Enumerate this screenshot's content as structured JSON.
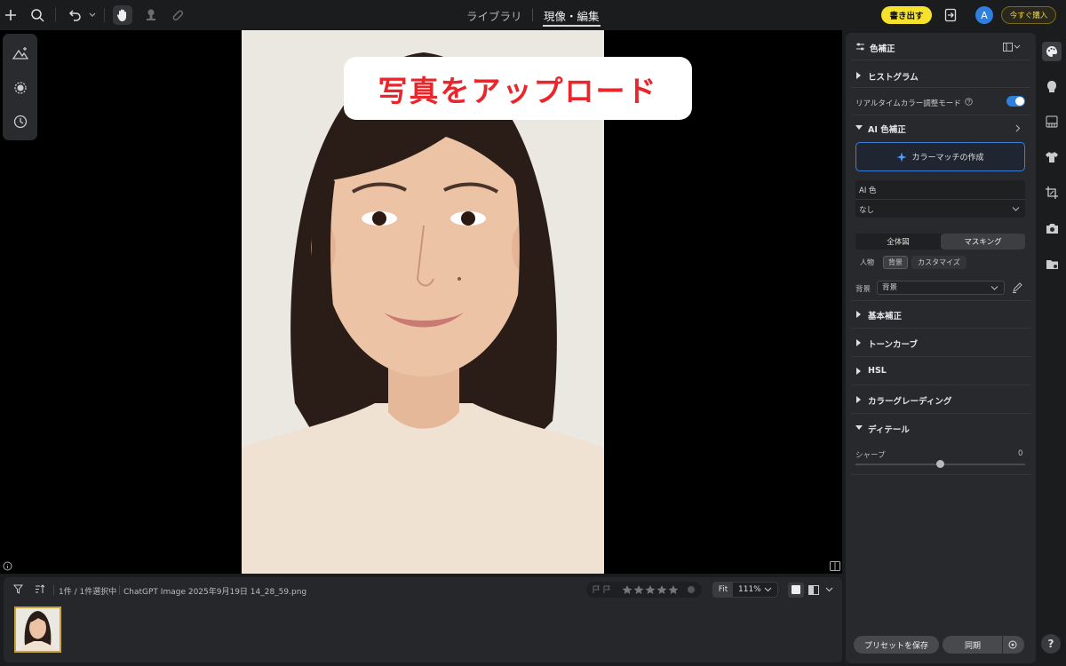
{
  "topbar": {
    "tabs": [
      {
        "label": "ライブラリ",
        "active": false
      },
      {
        "label": "現像・編集",
        "active": true
      }
    ],
    "export_label": "書き出す",
    "avatar_initial": "A",
    "buy_label": "今すぐ購入",
    "colors": {
      "export_bg": "#f6e12c",
      "avatar_bg": "#2f7fe0",
      "buy_text": "#f1d84a"
    }
  },
  "canvas": {
    "overlay_text": "写真をアップロード",
    "overlay_color": "#e8262b"
  },
  "filmstrip": {
    "selection_text": "1件 / 1件選択中",
    "file_name": "ChatGPT Image 2025年9月19日 14_28_59.png",
    "fit_label": "Fit",
    "zoom": "111%",
    "stars": 0
  },
  "panel": {
    "title": "色補正",
    "histogram": "ヒストグラム",
    "realtime_label": "リアルタイムカラー調整モード",
    "realtime_on": true,
    "ai_section": "AI 色補正",
    "colormatch_label": "カラーマッチの作成",
    "ai_color_label": "AI 色",
    "ai_color_value": "なし",
    "segments": [
      "全体図",
      "マスキング"
    ],
    "chips": [
      "人物",
      "背景",
      "カスタマイズ"
    ],
    "bg_label": "背景",
    "bg_select_value": "背景",
    "sections": [
      "基本補正",
      "トーンカーブ",
      "HSL",
      "カラーグレーディング",
      "ディテール"
    ],
    "sharpen_label": "シャープ",
    "sharpen_value": "0",
    "preset_label": "プリセットを保存",
    "sync_label": "同期"
  },
  "sidebar_icons": [
    "palette-icon",
    "face-icon",
    "film-icon",
    "shirt-icon",
    "crop-icon",
    "camera-icon",
    "folder-icon"
  ],
  "help_label": "?"
}
